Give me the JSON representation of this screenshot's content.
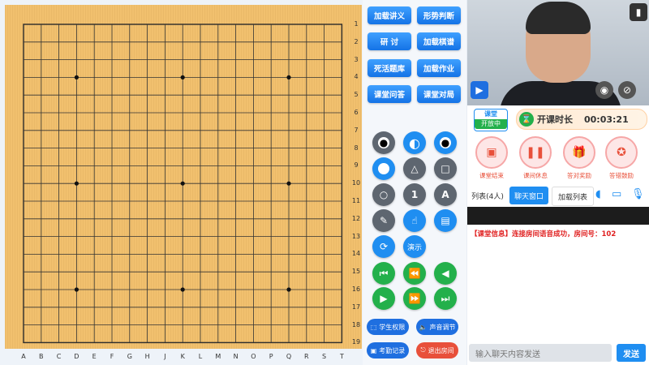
{
  "board": {
    "size": 19,
    "col_labels": [
      "A",
      "B",
      "C",
      "D",
      "E",
      "F",
      "G",
      "H",
      "J",
      "K",
      "L",
      "M",
      "N",
      "O",
      "P",
      "Q",
      "R",
      "S",
      "T"
    ],
    "row_labels": [
      "1",
      "2",
      "3",
      "4",
      "5",
      "6",
      "7",
      "8",
      "9",
      "10",
      "11",
      "12",
      "13",
      "14",
      "15",
      "16",
      "17",
      "18",
      "19"
    ]
  },
  "tools": {
    "buttons": [
      {
        "label": "加载讲义"
      },
      {
        "label": "形势判断"
      },
      {
        "label": "研 讨"
      },
      {
        "label": "加载棋谱"
      },
      {
        "label": "死活题库"
      },
      {
        "label": "加载作业"
      },
      {
        "label": "课堂问答"
      },
      {
        "label": "课堂对局"
      }
    ],
    "icon_buttons": [
      {
        "name": "black-stone-icon",
        "glyph": "●"
      },
      {
        "name": "half-stone-icon",
        "glyph": "◐"
      },
      {
        "name": "black-white-stone-icon",
        "glyph": "◉"
      },
      {
        "name": "white-stone-icon",
        "glyph": "●"
      },
      {
        "name": "triangle-icon",
        "glyph": "△"
      },
      {
        "name": "square-icon",
        "glyph": "□"
      },
      {
        "name": "circle-icon",
        "glyph": "○"
      },
      {
        "name": "number-icon",
        "glyph": "1"
      },
      {
        "name": "letter-icon",
        "glyph": "A"
      },
      {
        "name": "brush-icon",
        "glyph": "✎"
      },
      {
        "name": "hand-icon",
        "glyph": "☝"
      },
      {
        "name": "paint-roller-icon",
        "glyph": "▤"
      },
      {
        "name": "refresh-icon",
        "glyph": "⟳"
      }
    ],
    "demo_label": "演示",
    "nav_icons": [
      {
        "name": "first-move-icon",
        "glyph": "⏮"
      },
      {
        "name": "rewind-icon",
        "glyph": "⏪"
      },
      {
        "name": "prev-move-icon",
        "glyph": "◀"
      },
      {
        "name": "next-move-icon",
        "glyph": "▶"
      },
      {
        "name": "fast-forward-icon",
        "glyph": "⏩"
      },
      {
        "name": "last-move-icon",
        "glyph": "⏭"
      }
    ],
    "pills": [
      {
        "label": "学生权限",
        "icon": "⬚",
        "color": "#1f6fe0"
      },
      {
        "label": "声音调节",
        "icon": "🔈",
        "color": "#1f6fe0"
      },
      {
        "label": "考勤记录",
        "icon": "▣",
        "color": "#1f6fe0"
      },
      {
        "label": "退出房间",
        "icon": "⎋",
        "color": "#e8503a"
      }
    ]
  },
  "class": {
    "badge_top": "课堂",
    "badge_bottom": "开放中",
    "timer_label": "开课时长",
    "timer_value": "00:03:21"
  },
  "actions": [
    {
      "label": "课堂结束",
      "icon": "▣"
    },
    {
      "label": "课间休息",
      "icon": "❚❚"
    },
    {
      "label": "答对奖励",
      "icon": "🎁"
    },
    {
      "label": "答错鼓励",
      "icon": "✪"
    }
  ],
  "chat": {
    "tabs": [
      "列表(4人)",
      "聊天窗口",
      "加载列表"
    ],
    "message_prefix": "【课堂信息】",
    "message_text": "连接房间语音成功，房间号：102",
    "input_placeholder": "输入聊天内容发送",
    "send_label": "发送"
  },
  "colors": {
    "board": "#f1c06e",
    "primary": "#1f8ef1",
    "accent": "#e8503a",
    "green": "#23b04b"
  }
}
